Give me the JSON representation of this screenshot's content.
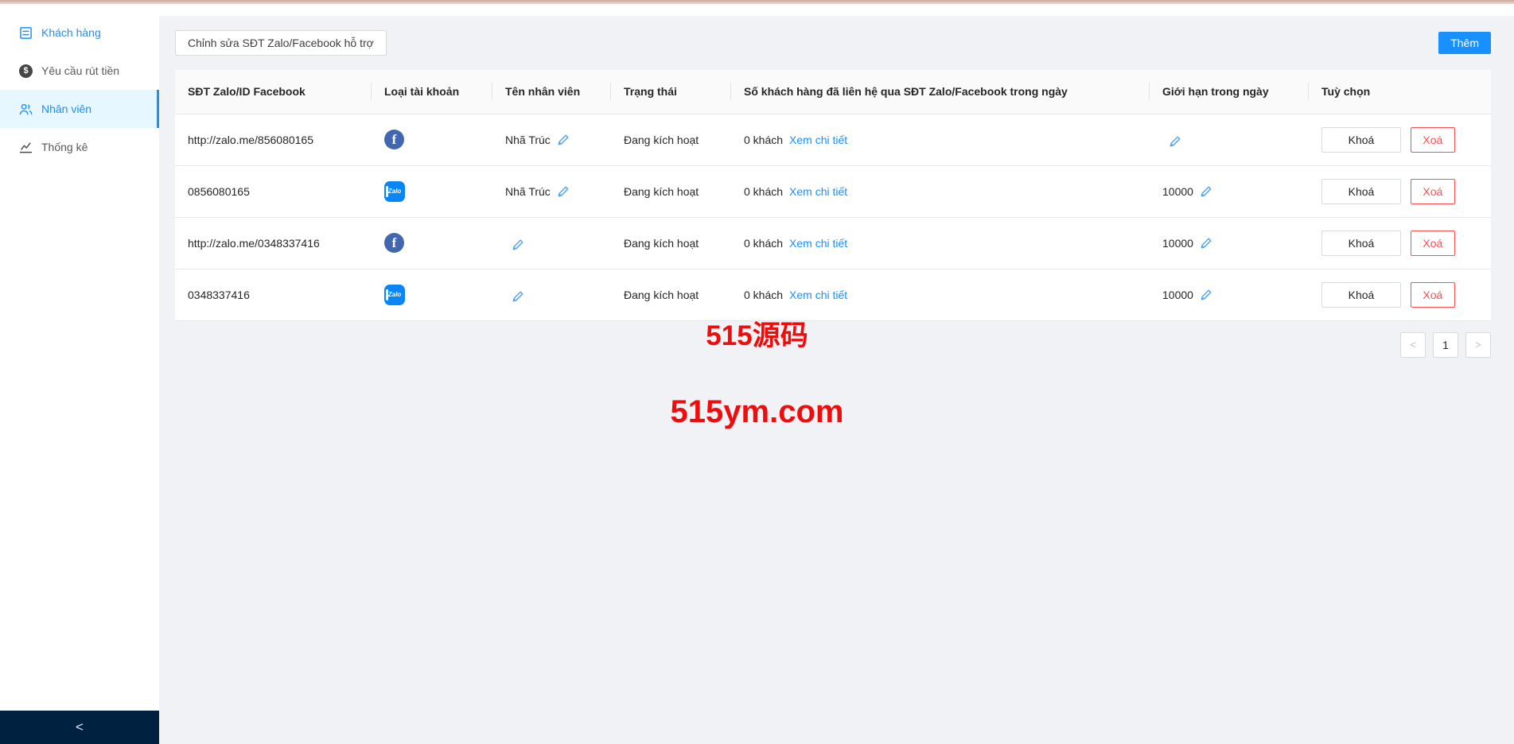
{
  "sidebar": {
    "items": [
      {
        "label": "Khách hàng",
        "icon": "profile-icon"
      },
      {
        "label": "Yêu cầu rút tiền",
        "icon": "dollar-circle-icon"
      },
      {
        "label": "Nhân viên",
        "icon": "team-icon",
        "active": true
      },
      {
        "label": "Thống kê",
        "icon": "line-chart-icon"
      }
    ],
    "collapse_icon": "<"
  },
  "toolbar": {
    "edit_support_label": "Chỉnh sửa SĐT Zalo/Facebook hỗ trợ",
    "add_label": "Thêm"
  },
  "icons": {
    "facebook_letter": "f",
    "zalo_label": "Zalo",
    "dollar": "$"
  },
  "table": {
    "columns": [
      "SĐT Zalo/ID Facebook",
      "Loại tài khoản",
      "Tên nhân viên",
      "Trạng thái",
      "Số khách hàng đã liên hệ qua SĐT Zalo/Facebook trong ngày",
      "Giới hạn trong ngày",
      "Tuỳ chọn"
    ],
    "actions": {
      "lock": "Khoá",
      "delete": "Xoá"
    },
    "rows": [
      {
        "contact": "http://zalo.me/856080165",
        "account_type": "facebook",
        "employee_name": "Nhã Trúc",
        "status": "Đang kích hoạt",
        "contacted": "0 khách",
        "detail_link": "Xem chi tiết",
        "daily_limit": ""
      },
      {
        "contact": "0856080165",
        "account_type": "zalo",
        "employee_name": "Nhã Trúc",
        "status": "Đang kích hoạt",
        "contacted": "0 khách",
        "detail_link": "Xem chi tiết",
        "daily_limit": "10000"
      },
      {
        "contact": "http://zalo.me/0348337416",
        "account_type": "facebook",
        "employee_name": "",
        "status": "Đang kích hoạt",
        "contacted": "0 khách",
        "detail_link": "Xem chi tiết",
        "daily_limit": "10000"
      },
      {
        "contact": "0348337416",
        "account_type": "zalo",
        "employee_name": "",
        "status": "Đang kích hoạt",
        "contacted": "0 khách",
        "detail_link": "Xem chi tiết",
        "daily_limit": "10000"
      }
    ]
  },
  "pagination": {
    "prev": "<",
    "current": "1",
    "next": ">"
  },
  "watermark": {
    "line1": "515源码",
    "line2": "515ym.com"
  },
  "colors": {
    "accent": "#1890ff",
    "danger": "#ff4d4f",
    "watermark_red": "#ee0d0d",
    "sidebar_footer": "#002140",
    "active_item_bg": "#e6f7ff",
    "topbar": "#d5b2a7",
    "main_bg": "#f0f2f5"
  }
}
